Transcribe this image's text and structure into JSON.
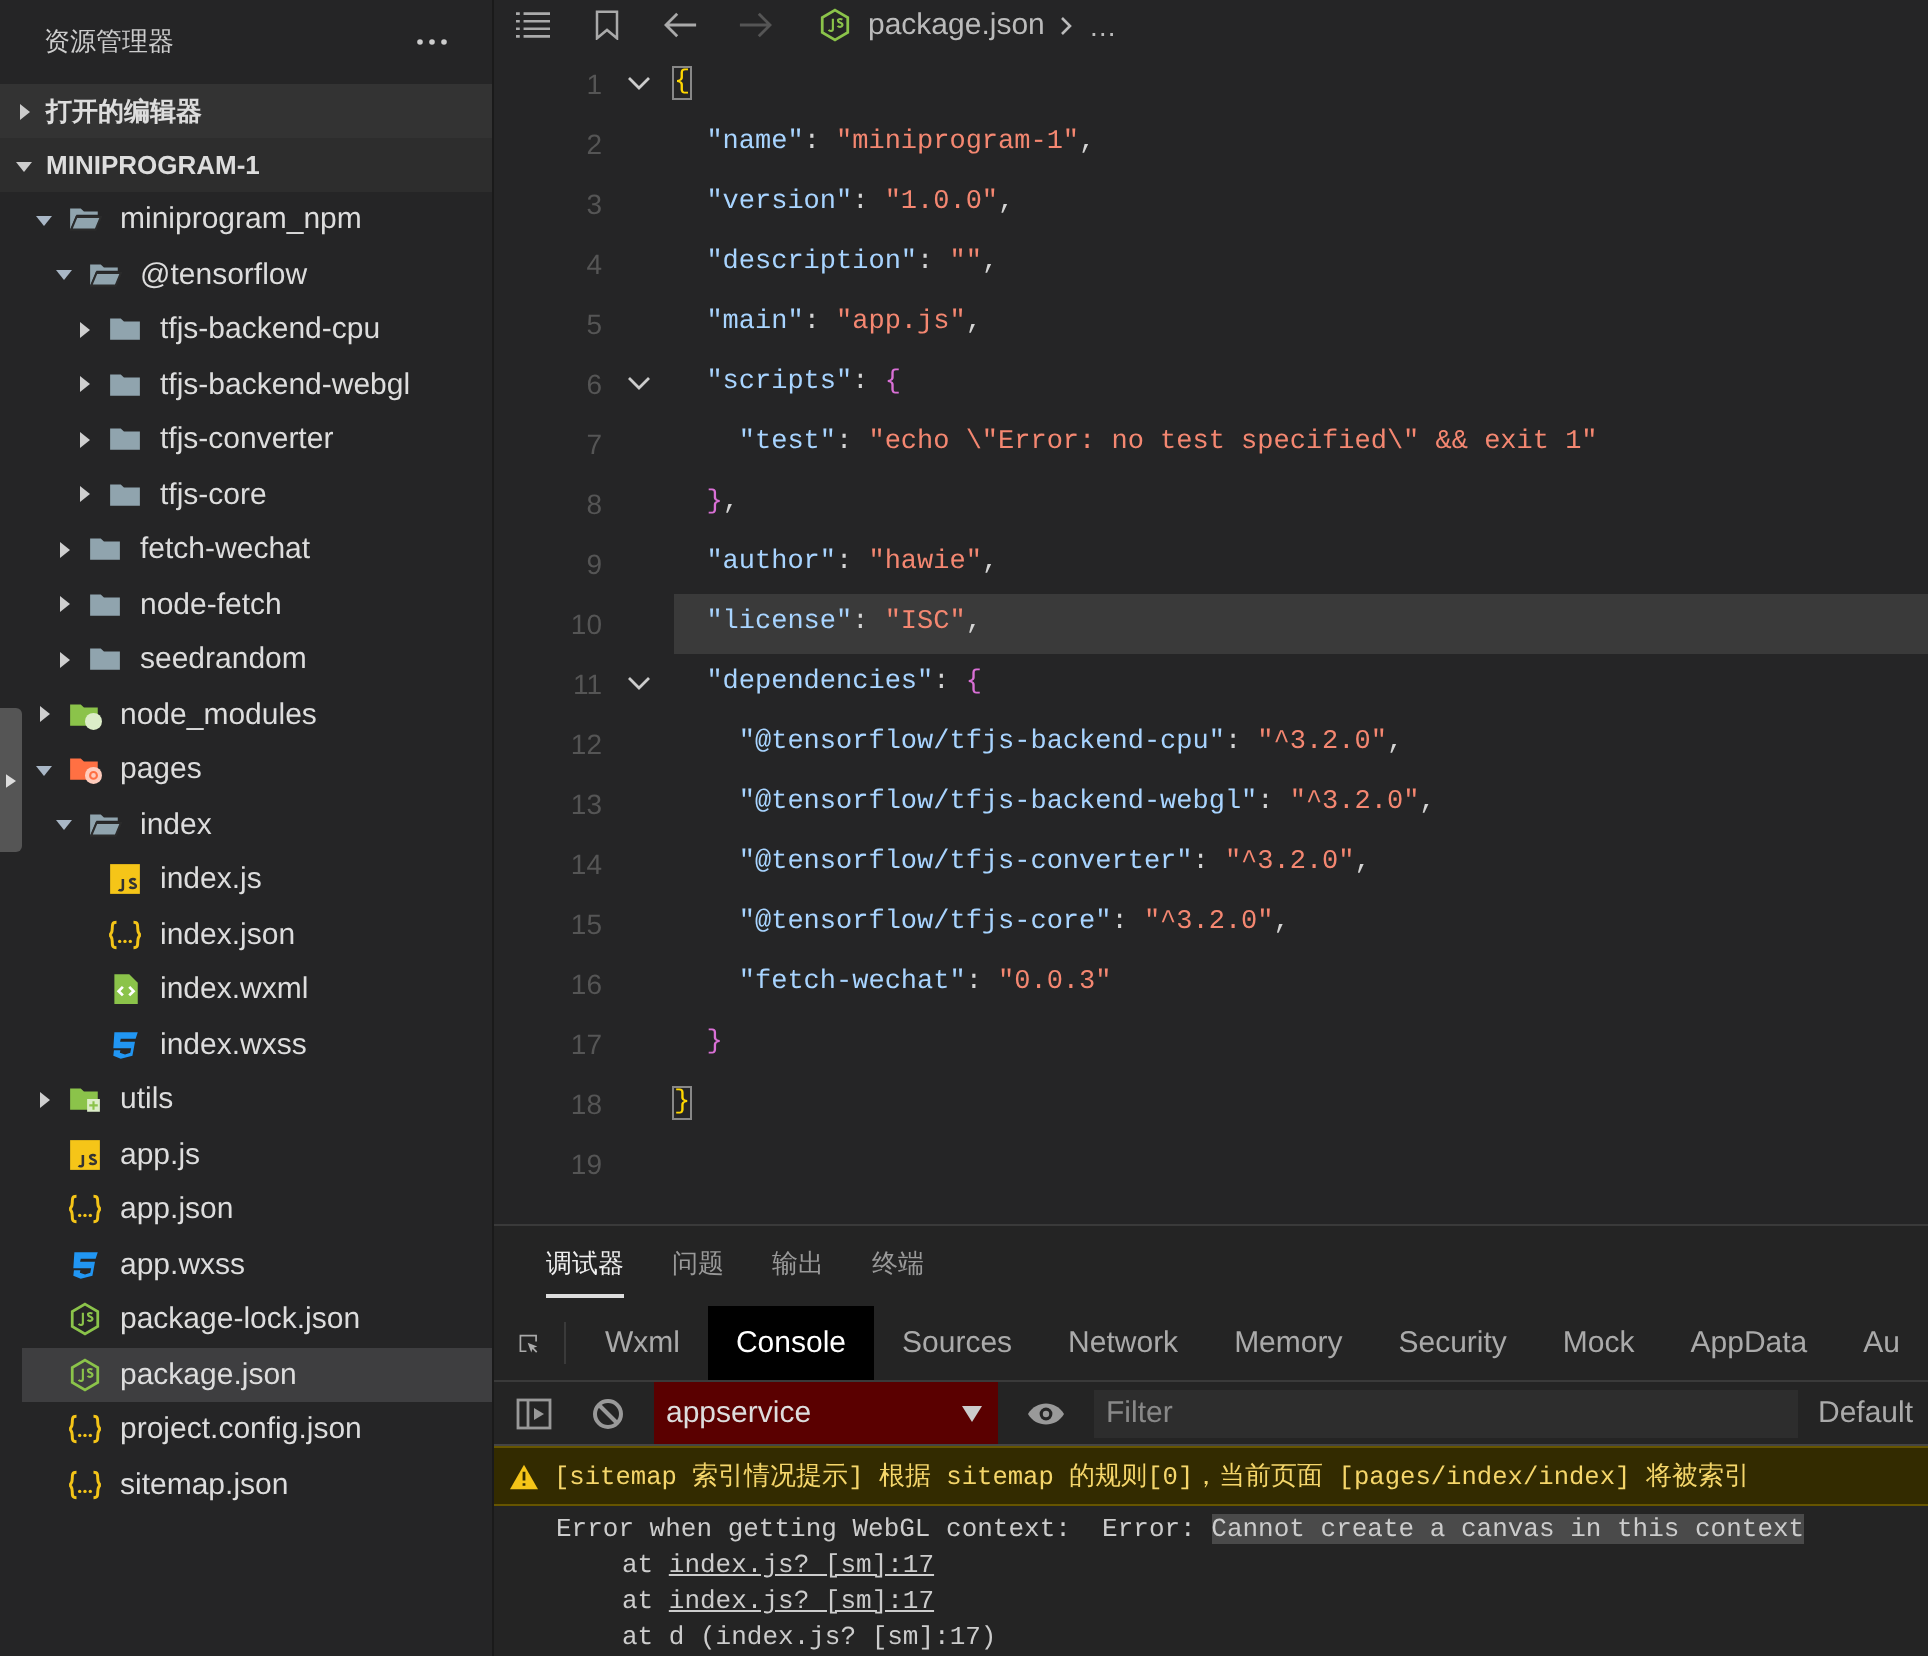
{
  "sidebar": {
    "title": "资源管理器",
    "sections": [
      {
        "label": "打开的编辑器",
        "expanded": false
      },
      {
        "label": "MINIPROGRAM-1",
        "expanded": true
      }
    ],
    "tree": [
      {
        "label": "miniprogram_npm",
        "kind": "folder",
        "expanded": true,
        "selected": false,
        "children": [
          {
            "label": "@tensorflow",
            "kind": "folder",
            "expanded": true,
            "selected": false,
            "children": [
              {
                "label": "tfjs-backend-cpu",
                "kind": "folder",
                "expanded": false,
                "selected": false
              },
              {
                "label": "tfjs-backend-webgl",
                "kind": "folder",
                "expanded": false,
                "selected": false
              },
              {
                "label": "tfjs-converter",
                "kind": "folder",
                "expanded": false,
                "selected": false
              },
              {
                "label": "tfjs-core",
                "kind": "folder",
                "expanded": false,
                "selected": false
              }
            ]
          },
          {
            "label": "fetch-wechat",
            "kind": "folder",
            "expanded": false,
            "selected": false
          },
          {
            "label": "node-fetch",
            "kind": "folder",
            "expanded": false,
            "selected": false
          },
          {
            "label": "seedrandom",
            "kind": "folder",
            "expanded": false,
            "selected": false
          }
        ]
      },
      {
        "label": "node_modules",
        "kind": "folder-node",
        "expanded": false,
        "selected": false
      },
      {
        "label": "pages",
        "kind": "folder-pages",
        "expanded": true,
        "selected": false,
        "children": [
          {
            "label": "index",
            "kind": "folder",
            "expanded": true,
            "selected": false,
            "children": [
              {
                "label": "index.js",
                "kind": "js",
                "selected": false
              },
              {
                "label": "index.json",
                "kind": "json",
                "selected": false
              },
              {
                "label": "index.wxml",
                "kind": "wxml",
                "selected": false
              },
              {
                "label": "index.wxss",
                "kind": "wxss",
                "selected": false
              }
            ]
          }
        ]
      },
      {
        "label": "utils",
        "kind": "folder-utils",
        "expanded": false,
        "selected": false
      },
      {
        "label": "app.js",
        "kind": "js",
        "selected": false
      },
      {
        "label": "app.json",
        "kind": "json",
        "selected": false
      },
      {
        "label": "app.wxss",
        "kind": "wxss",
        "selected": false
      },
      {
        "label": "package-lock.json",
        "kind": "node",
        "selected": false
      },
      {
        "label": "package.json",
        "kind": "node",
        "selected": true
      },
      {
        "label": "project.config.json",
        "kind": "json",
        "selected": false
      },
      {
        "label": "sitemap.json",
        "kind": "json",
        "selected": false
      }
    ]
  },
  "editor": {
    "breadcrumb": {
      "file": "package.json",
      "more": "…"
    },
    "lines": [
      {
        "number": "1",
        "foldable": true,
        "current": false,
        "tokens": [
          {
            "text": "{",
            "kind": "brace-match"
          }
        ]
      },
      {
        "number": "2",
        "foldable": false,
        "current": false,
        "tokens": [
          {
            "text": "  \"name\"",
            "kind": "key"
          },
          {
            "text": ": ",
            "kind": "punct"
          },
          {
            "text": "\"miniprogram-1\"",
            "kind": "string"
          },
          {
            "text": ",",
            "kind": "punct"
          }
        ]
      },
      {
        "number": "3",
        "foldable": false,
        "current": false,
        "tokens": [
          {
            "text": "  \"version\"",
            "kind": "key"
          },
          {
            "text": ": ",
            "kind": "punct"
          },
          {
            "text": "\"1.0.0\"",
            "kind": "string"
          },
          {
            "text": ",",
            "kind": "punct"
          }
        ]
      },
      {
        "number": "4",
        "foldable": false,
        "current": false,
        "tokens": [
          {
            "text": "  \"description\"",
            "kind": "key"
          },
          {
            "text": ": ",
            "kind": "punct"
          },
          {
            "text": "\"\"",
            "kind": "string"
          },
          {
            "text": ",",
            "kind": "punct"
          }
        ]
      },
      {
        "number": "5",
        "foldable": false,
        "current": false,
        "tokens": [
          {
            "text": "  \"main\"",
            "kind": "key"
          },
          {
            "text": ": ",
            "kind": "punct"
          },
          {
            "text": "\"app.js\"",
            "kind": "string"
          },
          {
            "text": ",",
            "kind": "punct"
          }
        ]
      },
      {
        "number": "6",
        "foldable": true,
        "current": false,
        "tokens": [
          {
            "text": "  \"scripts\"",
            "kind": "key"
          },
          {
            "text": ": ",
            "kind": "punct"
          },
          {
            "text": "{",
            "kind": "brace"
          }
        ]
      },
      {
        "number": "7",
        "foldable": false,
        "current": false,
        "tokens": [
          {
            "text": "    \"test\"",
            "kind": "key"
          },
          {
            "text": ": ",
            "kind": "punct"
          },
          {
            "text": "\"echo \\\"Error: no test specified\\\" && exit 1\"",
            "kind": "string"
          }
        ]
      },
      {
        "number": "8",
        "foldable": false,
        "current": false,
        "tokens": [
          {
            "text": "  }",
            "kind": "brace"
          },
          {
            "text": ",",
            "kind": "punct"
          }
        ]
      },
      {
        "number": "9",
        "foldable": false,
        "current": false,
        "tokens": [
          {
            "text": "  \"author\"",
            "kind": "key"
          },
          {
            "text": ": ",
            "kind": "punct"
          },
          {
            "text": "\"hawie\"",
            "kind": "string"
          },
          {
            "text": ",",
            "kind": "punct"
          }
        ]
      },
      {
        "number": "10",
        "foldable": false,
        "current": true,
        "tokens": [
          {
            "text": "  \"license\"",
            "kind": "key"
          },
          {
            "text": ": ",
            "kind": "punct"
          },
          {
            "text": "\"ISC\"",
            "kind": "string"
          },
          {
            "text": ",",
            "kind": "punct"
          }
        ]
      },
      {
        "number": "11",
        "foldable": true,
        "current": false,
        "tokens": [
          {
            "text": "  \"dependencies\"",
            "kind": "key"
          },
          {
            "text": ": ",
            "kind": "punct"
          },
          {
            "text": "{",
            "kind": "brace"
          }
        ]
      },
      {
        "number": "12",
        "foldable": false,
        "current": false,
        "tokens": [
          {
            "text": "    \"@tensorflow/tfjs-backend-cpu\"",
            "kind": "key"
          },
          {
            "text": ": ",
            "kind": "punct"
          },
          {
            "text": "\"^3.2.0\"",
            "kind": "string"
          },
          {
            "text": ",",
            "kind": "punct"
          }
        ]
      },
      {
        "number": "13",
        "foldable": false,
        "current": false,
        "tokens": [
          {
            "text": "    \"@tensorflow/tfjs-backend-webgl\"",
            "kind": "key"
          },
          {
            "text": ": ",
            "kind": "punct"
          },
          {
            "text": "\"^3.2.0\"",
            "kind": "string"
          },
          {
            "text": ",",
            "kind": "punct"
          }
        ]
      },
      {
        "number": "14",
        "foldable": false,
        "current": false,
        "tokens": [
          {
            "text": "    \"@tensorflow/tfjs-converter\"",
            "kind": "key"
          },
          {
            "text": ": ",
            "kind": "punct"
          },
          {
            "text": "\"^3.2.0\"",
            "kind": "string"
          },
          {
            "text": ",",
            "kind": "punct"
          }
        ]
      },
      {
        "number": "15",
        "foldable": false,
        "current": false,
        "tokens": [
          {
            "text": "    \"@tensorflow/tfjs-core\"",
            "kind": "key"
          },
          {
            "text": ": ",
            "kind": "punct"
          },
          {
            "text": "\"^3.2.0\"",
            "kind": "string"
          },
          {
            "text": ",",
            "kind": "punct"
          }
        ]
      },
      {
        "number": "16",
        "foldable": false,
        "current": false,
        "tokens": [
          {
            "text": "    \"fetch-wechat\"",
            "kind": "key"
          },
          {
            "text": ": ",
            "kind": "punct"
          },
          {
            "text": "\"0.0.3\"",
            "kind": "string"
          }
        ]
      },
      {
        "number": "17",
        "foldable": false,
        "current": false,
        "tokens": [
          {
            "text": "  }",
            "kind": "brace"
          }
        ]
      },
      {
        "number": "18",
        "foldable": false,
        "current": false,
        "tokens": [
          {
            "text": "}",
            "kind": "brace-match"
          }
        ]
      },
      {
        "number": "19",
        "foldable": false,
        "current": false
      }
    ]
  },
  "panel": {
    "tabs": [
      {
        "label": "调试器",
        "selected": true
      },
      {
        "label": "问题",
        "selected": false
      },
      {
        "label": "输出",
        "selected": false
      },
      {
        "label": "终端",
        "selected": false
      }
    ],
    "devtools_tabs": [
      {
        "label": "Wxml",
        "selected": false
      },
      {
        "label": "Console",
        "selected": true
      },
      {
        "label": "Sources",
        "selected": false
      },
      {
        "label": "Network",
        "selected": false
      },
      {
        "label": "Memory",
        "selected": false
      },
      {
        "label": "Security",
        "selected": false
      },
      {
        "label": "Mock",
        "selected": false
      },
      {
        "label": "AppData",
        "selected": false
      },
      {
        "label": "Au",
        "selected": false
      }
    ],
    "toolbar": {
      "context": "appservice",
      "filter_placeholder": "Filter",
      "levels": "Default"
    },
    "messages": [
      {
        "kind": "warning",
        "text": "[sitemap 索引情况提示] 根据 sitemap 的规则[0]，当前页面 [pages/index/index] 将被索引"
      },
      {
        "kind": "error",
        "text": "Error when getting WebGL context:  Error: ",
        "highlight": "Cannot create a canvas in this context",
        "stack": [
          {
            "prefix": "at ",
            "link": "index.js? [sm]:17"
          },
          {
            "prefix": "at ",
            "link": "index.js? [sm]:17"
          },
          {
            "text": "at d (index.js? [sm]:17)"
          }
        ]
      }
    ]
  }
}
